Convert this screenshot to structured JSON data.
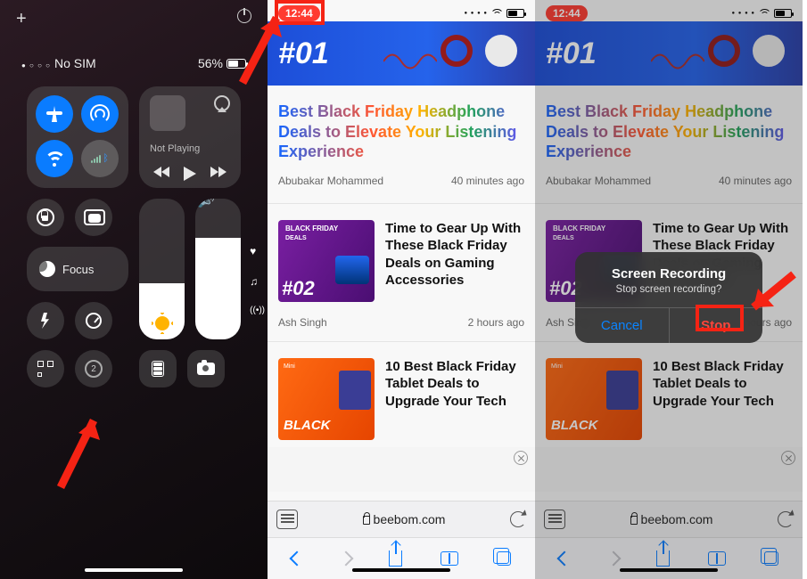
{
  "control_center": {
    "status": {
      "carrier": "No SIM",
      "battery_text": "56%"
    },
    "music": {
      "now_playing": "Not Playing"
    },
    "focus_label": "Focus",
    "record_badge": "2"
  },
  "safari": {
    "status_time": "12:44",
    "hero_number": "#01",
    "article1": {
      "title": "Best Black Friday Headphone Deals to Elevate Your Listening Experience",
      "author": "Abubakar Mohammed",
      "when": "40 minutes ago"
    },
    "article2": {
      "thumb_label_top": "BLACK FRIDAY",
      "thumb_label_sub": "DEALS",
      "thumb_number": "#02",
      "title": "Time to Gear Up With These Black Friday Deals on Gaming Accessories",
      "author": "Ash Singh",
      "when": "2 hours ago"
    },
    "article3": {
      "thumb_sub": "Mini",
      "thumb_text": "BLACK",
      "title": "10 Best Black Friday Tablet Deals to Upgrade Your Tech"
    },
    "address": "beebom.com"
  },
  "alert": {
    "title": "Screen Recording",
    "message": "Stop screen recording?",
    "cancel": "Cancel",
    "stop": "Stop"
  }
}
